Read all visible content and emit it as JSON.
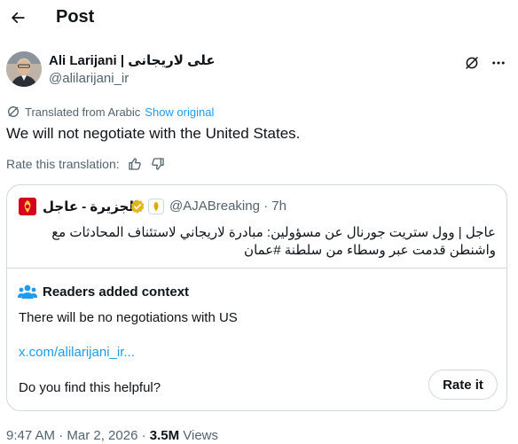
{
  "header": {
    "title": "Post"
  },
  "post": {
    "author_name": "Ali Larijani | علی لاریجانی",
    "handle": "@alilarijani_ir",
    "translated_label": "Translated from Arabic",
    "show_original": "Show original",
    "text": "We will not negotiate with the United States.",
    "rate_translation": "Rate this translation:"
  },
  "quote": {
    "name": "الجزيرة - عاجل",
    "handle_time": "@AJABreaking · 7h",
    "text": "عاجل | وول ستريت جورنال عن مسؤولين: مبادرة لاريجاني لاستئناف المحادثات مع واشنطن قدمت عبر وسطاء من سلطنة #عمان"
  },
  "context": {
    "title": "Readers added context",
    "body": "There will be no negotiations with US",
    "link": "x.com/alilarijani_ir...",
    "question": "Do you find this helpful?",
    "rate_button": "Rate it"
  },
  "meta": {
    "time_date": "9:47 AM · Mar 2, 2026 · ",
    "views_count": "3.5M",
    "views_label": " Views"
  }
}
